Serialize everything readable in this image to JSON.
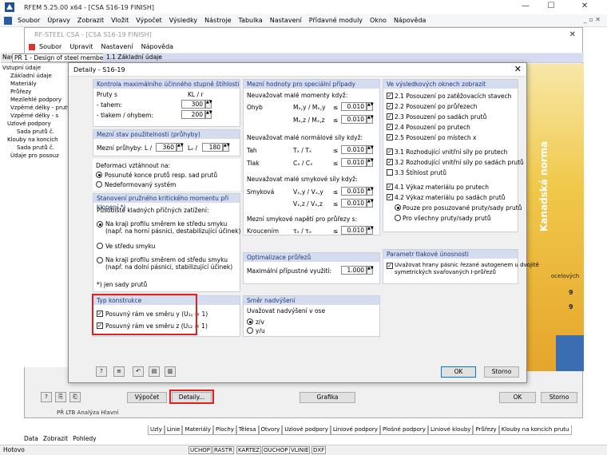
{
  "app": {
    "title": "RFEM 5.25.00 x64 - [CSA S16-19 FINISH]",
    "minimize": "—",
    "maximize": "☐",
    "close": "✕"
  },
  "menu": [
    "Soubor",
    "Úpravy",
    "Zobrazit",
    "Vložit",
    "Výpočet",
    "Výsledky",
    "Nástroje",
    "Tabulka",
    "Nastavení",
    "Přídavné moduly",
    "Okno",
    "Nápověda"
  ],
  "mdi_controls": "_ ▫ ✕",
  "rf": {
    "title": "RF-STEEL CSA - [CSA S16-19 FINISH]",
    "menu": [
      "Soubor",
      "Upravit",
      "Nastavení",
      "Nápověda"
    ],
    "close": "✕",
    "nav_combo": "PŘ 1 - Design of steel members",
    "section": "1.1 Základní údaje",
    "nav_prefix": "Nav",
    "tree": [
      "Vstupní údaje",
      "Základní údaje",
      "Materiály",
      "Průřezy",
      "Mezilehlé podpory",
      "Vzpěrné délky - pruty",
      "Vzpěrné délky - s",
      "Uzlové podpory",
      "Sada prutů č.",
      "Klouby na koncích",
      "Sada prutů č.",
      "Údaje pro posouz"
    ],
    "banner": "Kanadská norma",
    "banner_text": "ocelových",
    "banner_digits": [
      "9",
      "9"
    ],
    "bottom_btn1": "Výpočet",
    "bottom_btn2": "Detaily...",
    "bottom_btn3": "Grafika",
    "bottom_ok": "OK",
    "bottom_cancel": "Storno",
    "peek": "PŘ LTB   Analýza Hlavní"
  },
  "dialog": {
    "title": "Detaily - S16-19",
    "close": "✕",
    "g1": {
      "title": "Kontrola maximálního účinného stupně štíhlosti",
      "col": "KL / r",
      "rows": "Pruty s",
      "tah": "- tahem:",
      "tah_v": "300",
      "tlak": "- tlakem / ohybem:",
      "tlak_v": "200"
    },
    "g2": {
      "title": "Mezní stav použitelnosti (průhyby)",
      "lbl": "Mezní průhyby:",
      "L": "L /",
      "L_v": "360",
      "Lc": "Lₒ /",
      "Lc_v": "180"
    },
    "g3": {
      "title": "",
      "lbl": "Deformaci vztáhnout na:",
      "r1": "Posunuté konce prutů resp. sad prutů",
      "r2": "Nedeformovaný systém"
    },
    "g4": {
      "title": "Stanovení pružného kritického momentu při klopení *)",
      "lbl": "Působiště kladných příčných zatížení:",
      "r1": "Na kraji profilu směrem ke středu smyku",
      "r1b": "(např. na horní pásnici, destabilizující účinek)",
      "r2": "Ve středu smyku",
      "r3": "Na kraji profilu směrem od středu smyku",
      "r3b": "(např. na dolní pásnici, stabilizující účinek)",
      "note": "*) jen sady prutů"
    },
    "g5": {
      "title": "Typ konstrukce",
      "c1": "Posuvný rám ve směru y (U₁ᵧ = 1)",
      "c2": "Posuvný rám ve směru z (U₁₂ = 1)"
    },
    "m1": {
      "title": "Mezní hodnoty pro speciální případy",
      "h1": "Neuvažovat malé momenty když:",
      "ohyb": "Ohyb",
      "f1": "Mₓ,y / Mₓ,y",
      "v1": "0.010",
      "f2": "Mₓ,z / Mₓ,z",
      "v2": "0.010",
      "h2": "Neuvažovat malé normálové síly když:",
      "tah": "Tah",
      "f3": "Tₓ / Tₓ",
      "v3": "0.010",
      "tlak": "Tlak",
      "f4": "Cₓ / Cₓ",
      "v4": "0.010",
      "h3": "Neuvažovat malé smykové síly když:",
      "smyk": "Smyková",
      "f5": "Vₓ,y / Vₓ,y",
      "v5": "0.010",
      "f6": "Vₓ,z / Vₓ,z",
      "v6": "0.010",
      "h4": "Mezní smykové napětí pro průřezy s:",
      "kr": "Kroucením",
      "f7": "τₓ / τₓ",
      "v7": "0.010",
      "le": "≤"
    },
    "m2": {
      "title": "Optimalizace průřezů",
      "lbl": "Maximální přípustné využití:",
      "v": "1.000"
    },
    "m3": {
      "title": "Směr nadvýšení",
      "lbl": "Uvažovat nadvýšení v ose",
      "r1": "z/v",
      "r2": "y/u"
    },
    "r1": {
      "title": "Ve výsledkových oknech zobrazit",
      "items": [
        "2.1 Posouzení po zatěžovacích stavech",
        "2.2 Posouzení po průřezech",
        "2.3 Posouzení po sadách prutů",
        "2.4 Posouzení po prutech",
        "2.5 Posouzení po místech x",
        "3.1 Rozhodující vnitřní síly po prutech",
        "3.2 Rozhodující vnitřní síly po sadách prutů",
        "3.3 Štíhlost prutů",
        "4.1 Výkaz materiálu po prutech",
        "4.2 Výkaz materiálu po sadách prutů"
      ],
      "rb1": "Pouze pro posuzované pruty/sady prutů",
      "rb2": "Pro všechny pruty/sady prutů"
    },
    "r2": {
      "title": "Parametr tlakové únosnosti",
      "c1": "Uvažovat hrany pásnic řezané autogenem u dvojitě",
      "c1b": "symetrických svařovaných I-průřezů"
    },
    "ok": "OK",
    "cancel": "Storno"
  },
  "tabs": [
    "Uzly",
    "Linie",
    "Materiály",
    "Plochy",
    "Tělesa",
    "Otvory",
    "Uzlové podpory",
    "Liniové podpory",
    "Plošné podpory",
    "Liniové klouby",
    "Průřezy",
    "Klouby na koncích prutu"
  ],
  "left_tabs": [
    "Data",
    "Zobrazit",
    "Pohledy"
  ],
  "status": {
    "ready": "Hotovo",
    "items": [
      "UCHOP",
      "RASTR",
      "KARTEZ",
      "OUCHOP",
      "VLINIE",
      "DXF"
    ]
  }
}
